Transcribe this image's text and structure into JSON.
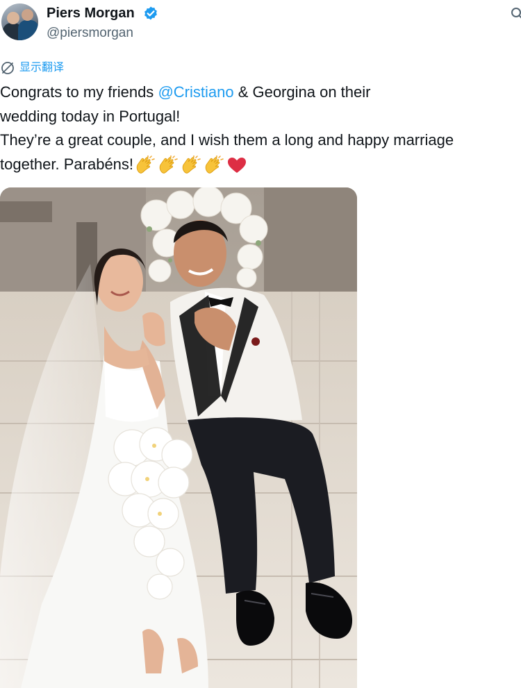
{
  "author": {
    "name": "Piers Morgan",
    "handle": "@piersmorgan",
    "verified": true,
    "verified_color": "#1d9bf0"
  },
  "translate": {
    "label": "显示翻译",
    "icon": "translate-globe-icon"
  },
  "tweet": {
    "line1_before": "Congrats to my friends ",
    "line1_mention": "@Cristiano",
    "line1_after": " & Georgina on their",
    "line2": "wedding today in Portugal!",
    "line3": "They’re a great couple, and I wish them a long and happy marriage",
    "line4": "together. Parabéns!",
    "emojis": [
      "clapping-hands-emoji",
      "clapping-hands-emoji",
      "clapping-hands-emoji",
      "clapping-hands-emoji",
      "red-heart-emoji"
    ],
    "mention_color": "#1d9bf0"
  },
  "media": {
    "type": "photo",
    "subject": "wedding-photo"
  }
}
